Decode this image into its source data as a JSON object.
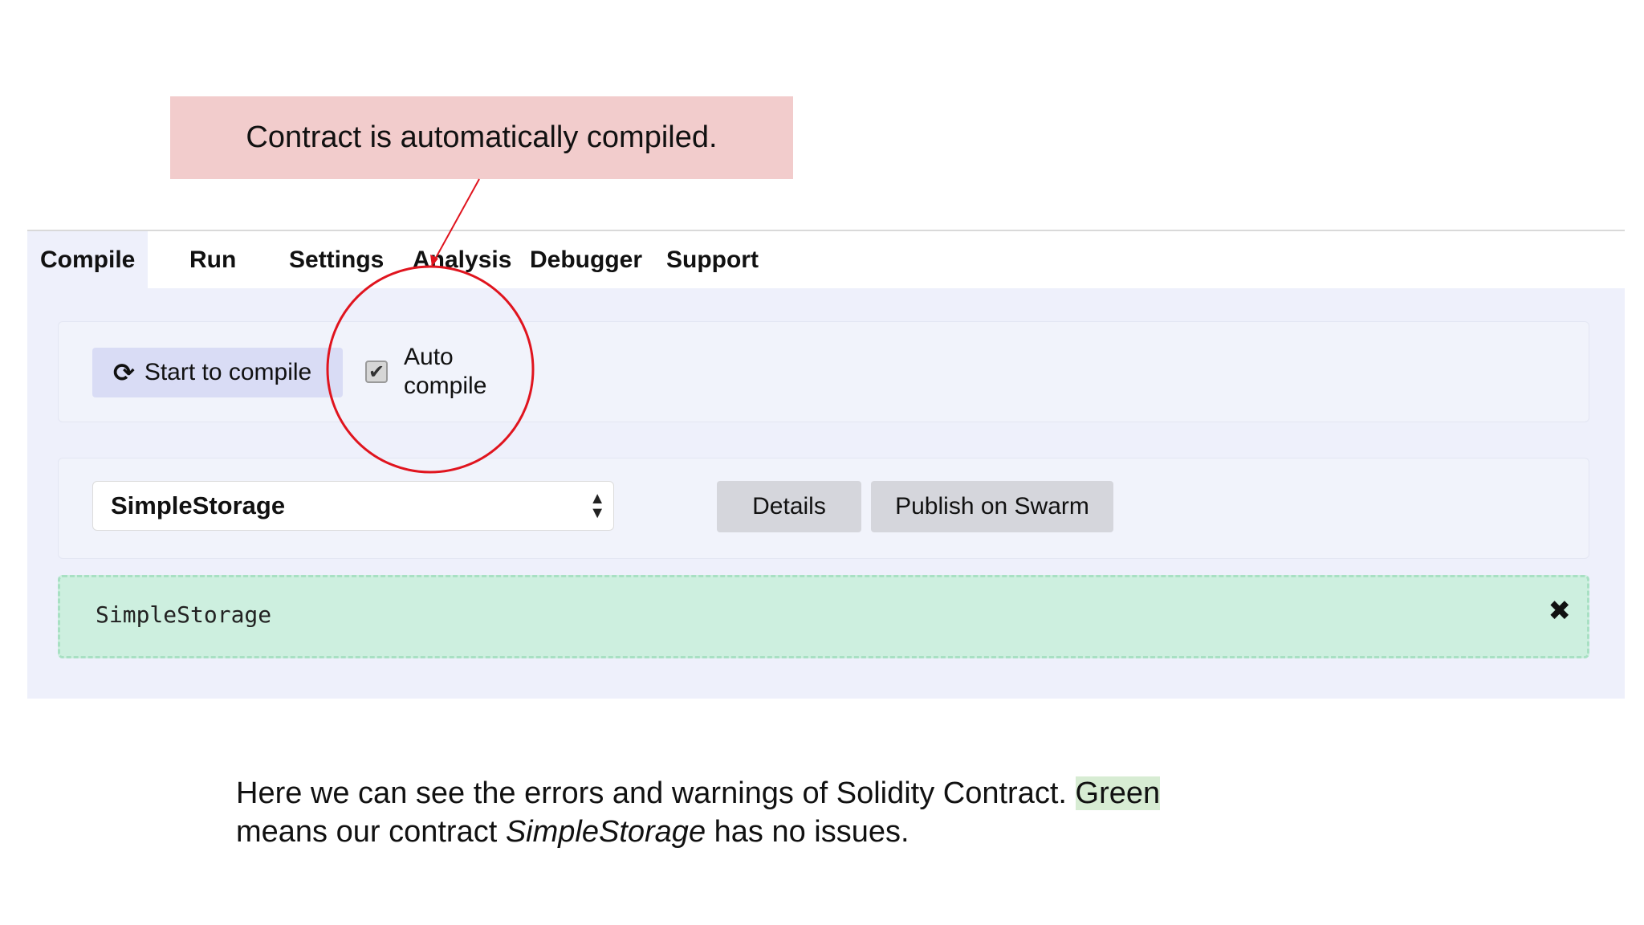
{
  "callout": {
    "text": "Contract is automatically compiled."
  },
  "tabs": [
    {
      "label": "Compile",
      "active": true
    },
    {
      "label": "Run",
      "active": false
    },
    {
      "label": "Settings",
      "active": false
    },
    {
      "label": "Analysis",
      "active": false
    },
    {
      "label": "Debugger",
      "active": false
    },
    {
      "label": "Support",
      "active": false
    }
  ],
  "compile": {
    "start_label": "Start to compile",
    "start_icon": "refresh-icon",
    "auto_compile_label_line1": "Auto",
    "auto_compile_label_line2": "compile",
    "auto_compile_checked": true
  },
  "contract_select": {
    "selected": "SimpleStorage"
  },
  "actions": {
    "details_label": "Details",
    "publish_label": "Publish on Swarm"
  },
  "result": {
    "text": "SimpleStorage",
    "close_glyph": "✖"
  },
  "caption": {
    "part1": "Here we can see the errors and warnings of Solidity Contract. ",
    "highlight": "Green",
    "part2": "means our contract ",
    "italic": "SimpleStorage",
    "part3": " has no issues."
  },
  "colors": {
    "callout_bg": "#f2cccc",
    "panel_bg": "#eef0fb",
    "result_bg": "#cdefdf",
    "annotation_red": "#e0141e",
    "highlight_green": "#d7ecd3"
  }
}
